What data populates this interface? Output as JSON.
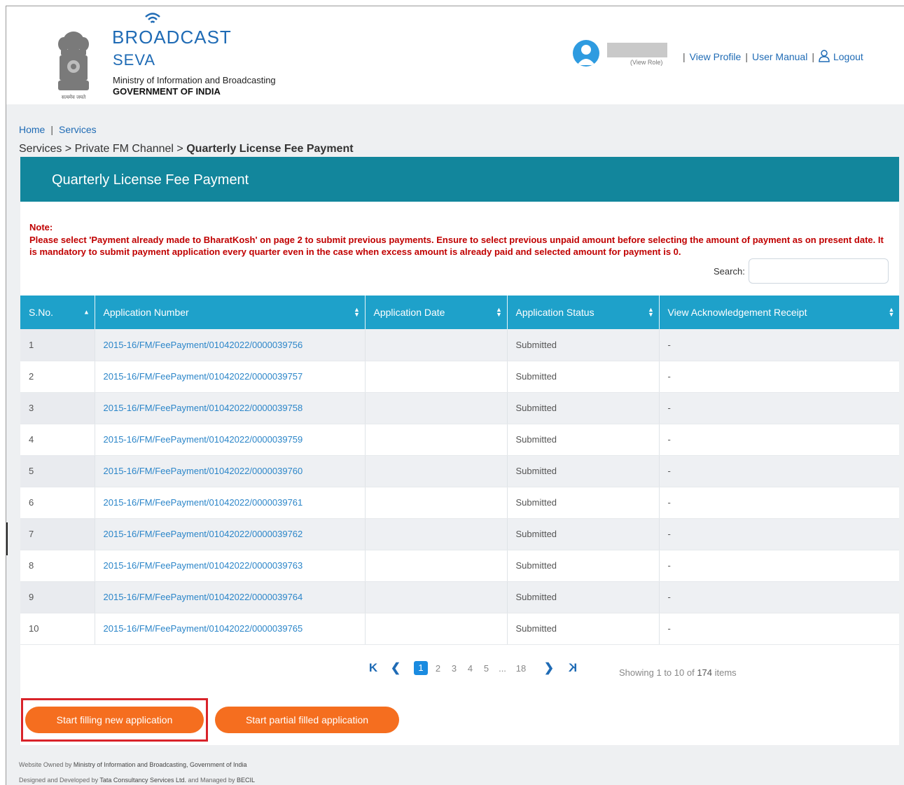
{
  "header": {
    "emblem_motto": "सत्यमेव जयते",
    "logo_broadcast": "BROADCAST",
    "logo_seva": "SEVA",
    "ministry": "Ministry of Information and Broadcasting",
    "government": "GOVERNMENT OF INDIA",
    "view_role": "(View Role)",
    "links": {
      "view_profile": "View Profile",
      "user_manual": "User Manual",
      "logout": "Logout"
    },
    "link_separator": "|"
  },
  "nav": {
    "home": "Home",
    "services": "Services",
    "separator": "|"
  },
  "breadcrumb": {
    "prefix": "Services > Private FM Channel > ",
    "current": "Quarterly License Fee Payment"
  },
  "panel": {
    "title": "Quarterly License Fee Payment",
    "note_title": "Note:",
    "note_text": "Please select 'Payment already made to BharatKosh' on page 2 to submit previous payments. Ensure to select previous unpaid amount before selecting the amount of payment as on present date. It is mandatory to submit payment application every quarter even in the case when excess amount is already paid and selected amount for payment is 0.",
    "search_label": "Search:",
    "search_value": ""
  },
  "table": {
    "columns": [
      "S.No.",
      "Application Number",
      "Application Date",
      "Application Status",
      "View Acknowledgement Receipt"
    ],
    "rows": [
      {
        "sno": "1",
        "number": "2015-16/FM/FeePayment/01042022/0000039756",
        "date": "",
        "status": "Submitted",
        "receipt": "-"
      },
      {
        "sno": "2",
        "number": "2015-16/FM/FeePayment/01042022/0000039757",
        "date": "",
        "status": "Submitted",
        "receipt": "-"
      },
      {
        "sno": "3",
        "number": "2015-16/FM/FeePayment/01042022/0000039758",
        "date": "",
        "status": "Submitted",
        "receipt": "-"
      },
      {
        "sno": "4",
        "number": "2015-16/FM/FeePayment/01042022/0000039759",
        "date": "",
        "status": "Submitted",
        "receipt": "-"
      },
      {
        "sno": "5",
        "number": "2015-16/FM/FeePayment/01042022/0000039760",
        "date": "",
        "status": "Submitted",
        "receipt": "-"
      },
      {
        "sno": "6",
        "number": "2015-16/FM/FeePayment/01042022/0000039761",
        "date": "",
        "status": "Submitted",
        "receipt": "-"
      },
      {
        "sno": "7",
        "number": "2015-16/FM/FeePayment/01042022/0000039762",
        "date": "",
        "status": "Submitted",
        "receipt": "-"
      },
      {
        "sno": "8",
        "number": "2015-16/FM/FeePayment/01042022/0000039763",
        "date": "",
        "status": "Submitted",
        "receipt": "-"
      },
      {
        "sno": "9",
        "number": "2015-16/FM/FeePayment/01042022/0000039764",
        "date": "",
        "status": "Submitted",
        "receipt": "-"
      },
      {
        "sno": "10",
        "number": "2015-16/FM/FeePayment/01042022/0000039765",
        "date": "",
        "status": "Submitted",
        "receipt": "-"
      }
    ]
  },
  "pagination": {
    "first_icon": "K",
    "prev_icon": "❮",
    "next_icon": "❯",
    "last_icon": "K",
    "pages": [
      "1",
      "2",
      "3",
      "4",
      "5",
      "...",
      "18"
    ],
    "active_page": "1",
    "info_prefix": "Showing 1 to 10 of ",
    "info_total": "174",
    "info_suffix": " items"
  },
  "buttons": {
    "new_application": "Start filling new application",
    "partial_application": "Start partial filled application"
  },
  "footer": {
    "owned_prefix": "Website Owned by ",
    "owned_by": "Ministry of Information and Broadcasting, Government of India",
    "designed_prefix": "Designed and Developed by ",
    "designed_by": "Tata Consultancy Services Ltd.",
    "managed_prefix": " and Managed by ",
    "managed_by": "BECIL"
  },
  "colors": {
    "panel_header": "#12869c",
    "table_header": "#1ea1ca",
    "note_red": "#c00000",
    "button_orange": "#f56e1f",
    "link_blue": "#1f6bb5",
    "highlight_red": "#d9232a"
  }
}
